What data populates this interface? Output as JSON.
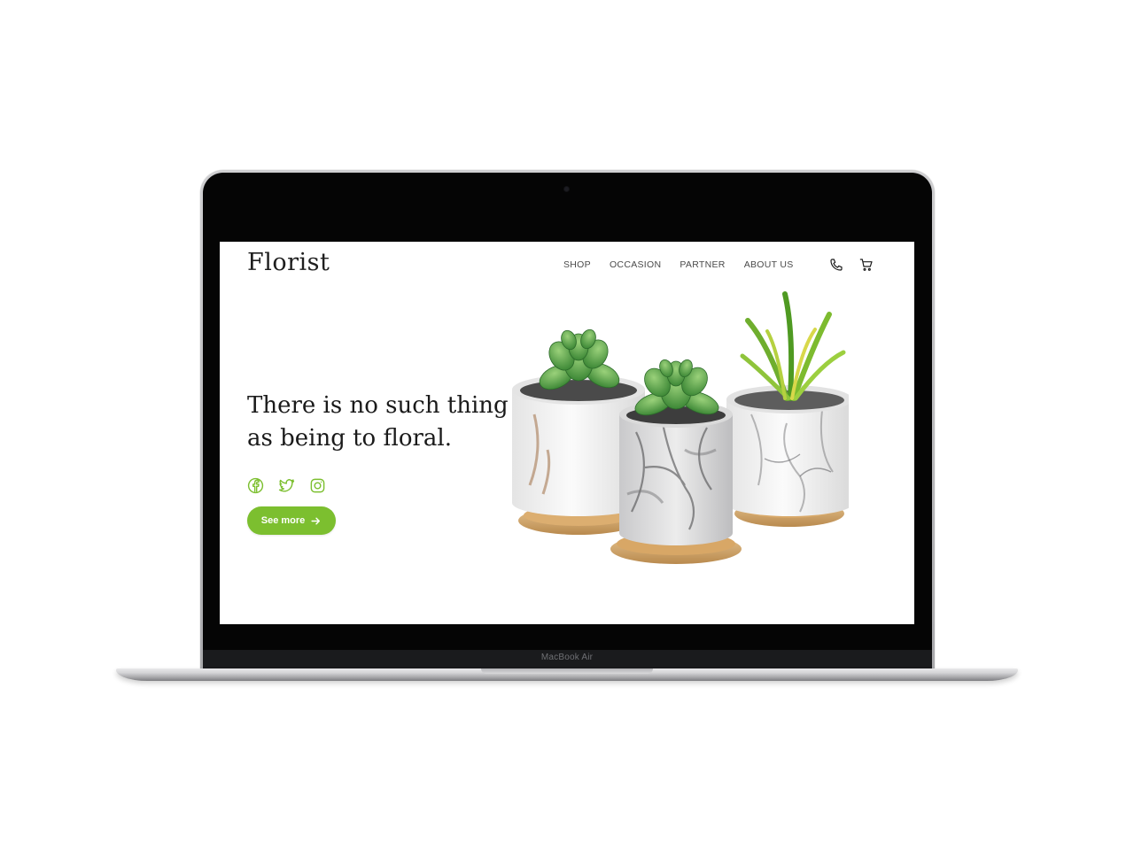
{
  "device": {
    "model_label": "MacBook Air"
  },
  "site": {
    "logo": "Florist",
    "nav": [
      {
        "label": "SHOP"
      },
      {
        "label": "OCCASION"
      },
      {
        "label": "PARTNER"
      },
      {
        "label": "ABOUT US"
      }
    ],
    "icons": {
      "phone": "phone-icon",
      "cart": "cart-icon"
    }
  },
  "hero": {
    "title_line1": "There is no such thing",
    "title_line2": "as being to floral.",
    "social": [
      "facebook-icon",
      "twitter-icon",
      "instagram-icon"
    ],
    "cta_label": "See more",
    "cta_icon": "arrow-right-icon",
    "image": "succulent-pots"
  },
  "colors": {
    "accent": "#7cbf2f",
    "text": "#1a1a1a",
    "nav_text": "#4a4a4a",
    "bezel": "#050505"
  }
}
